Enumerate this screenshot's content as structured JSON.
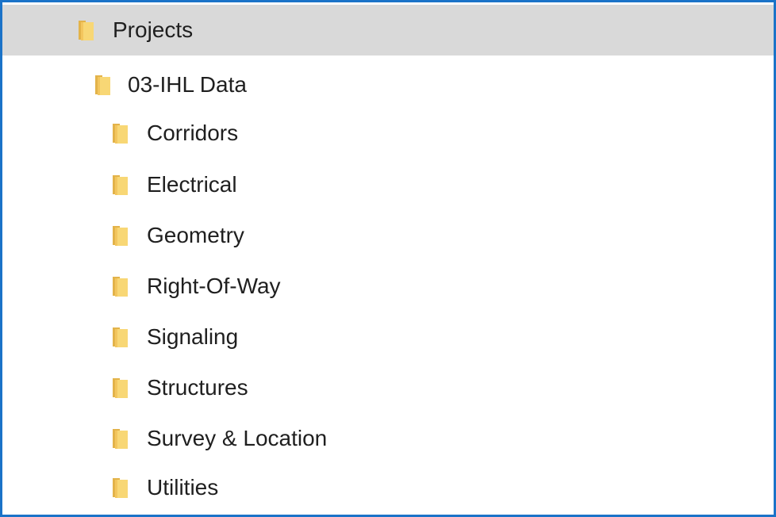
{
  "tree": {
    "root": {
      "label": "Projects",
      "icon": "folder-icon",
      "selected": true
    },
    "project": {
      "label": "03-IHL Data",
      "icon": "folder-icon"
    },
    "children": [
      {
        "label": "Corridors",
        "icon": "folder-icon"
      },
      {
        "label": "Electrical",
        "icon": "folder-icon"
      },
      {
        "label": "Geometry",
        "icon": "folder-icon"
      },
      {
        "label": "Right-Of-Way",
        "icon": "folder-icon"
      },
      {
        "label": "Signaling",
        "icon": "folder-icon"
      },
      {
        "label": "Structures",
        "icon": "folder-icon"
      },
      {
        "label": "Survey & Location",
        "icon": "folder-icon"
      },
      {
        "label": "Utilities",
        "icon": "folder-icon"
      }
    ]
  },
  "colors": {
    "border": "#1b73c8",
    "selected_row": "#d9d9d9",
    "folder_front": "#f8d775",
    "folder_back": "#e3b34a"
  }
}
